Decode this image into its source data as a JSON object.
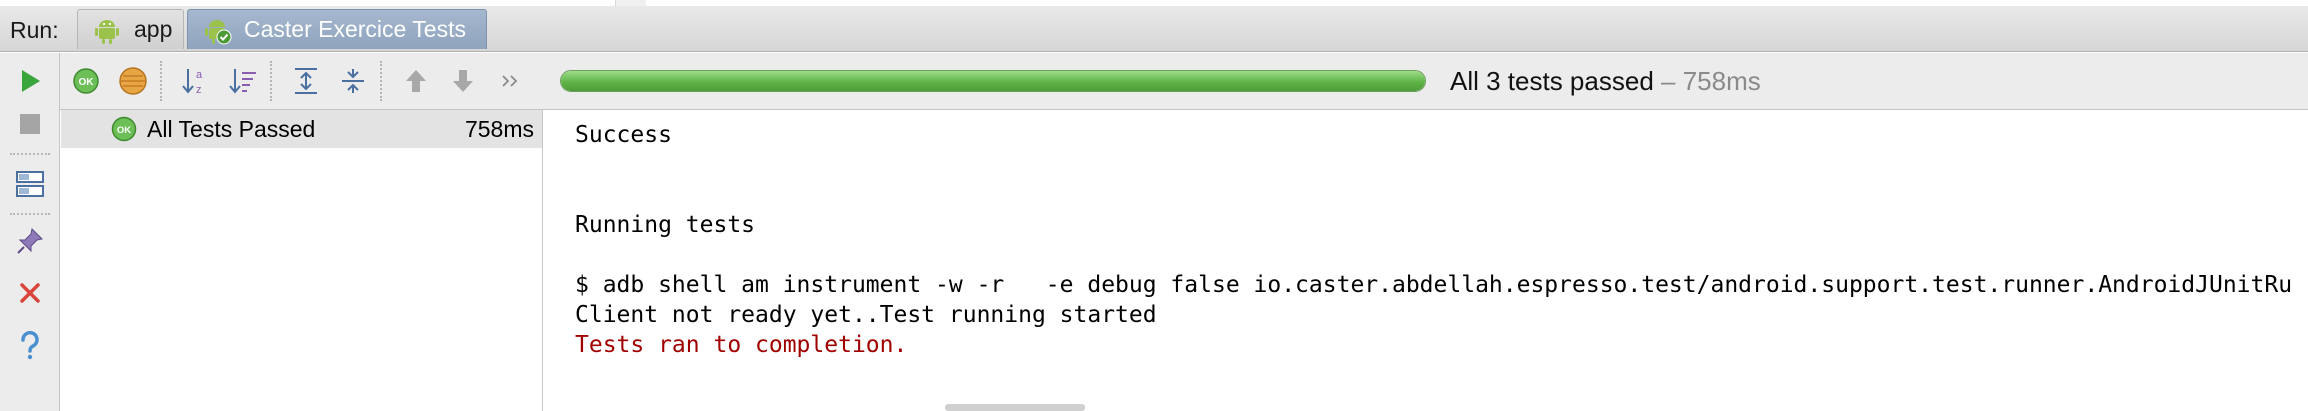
{
  "tab_bar": {
    "run_label": "Run:",
    "tabs": [
      {
        "label": "app",
        "icon": "android-icon",
        "active": false
      },
      {
        "label": "Caster Exercice Tests",
        "icon": "android-test-icon",
        "active": true
      }
    ]
  },
  "toolbar": {
    "icons": [
      "ok-filter-icon",
      "ignored-filter-icon",
      "sort-alpha-icon",
      "sort-duration-icon",
      "expand-all-icon",
      "collapse-all-icon",
      "previous-failed-icon",
      "next-failed-icon",
      "more-icon"
    ],
    "progress_percent": 100,
    "status_text": "All 3 tests passed",
    "status_duration": "– 758ms",
    "accent_green": "#5fb447"
  },
  "leftbar": {
    "icons": [
      "rerun-icon",
      "stop-icon",
      "layout-icon",
      "pin-icon",
      "close-icon",
      "help-icon"
    ]
  },
  "tree": {
    "rows": [
      {
        "label": "All Tests Passed",
        "time": "758ms",
        "icon": "ok-icon"
      }
    ]
  },
  "console": {
    "lines": [
      {
        "text": "Success",
        "color": "#000000"
      },
      {
        "text": "",
        "color": "#000000"
      },
      {
        "text": "",
        "color": "#000000"
      },
      {
        "text": "Running tests",
        "color": "#000000"
      },
      {
        "text": "",
        "color": "#000000"
      },
      {
        "text": "$ adb shell am instrument -w -r   -e debug false io.caster.abdellah.espresso.test/android.support.test.runner.AndroidJUnitRu",
        "color": "#000000"
      },
      {
        "text": "Client not ready yet..Test running started",
        "color": "#000000"
      },
      {
        "text": "Tests ran to completion.",
        "color": "#a00000"
      }
    ]
  }
}
